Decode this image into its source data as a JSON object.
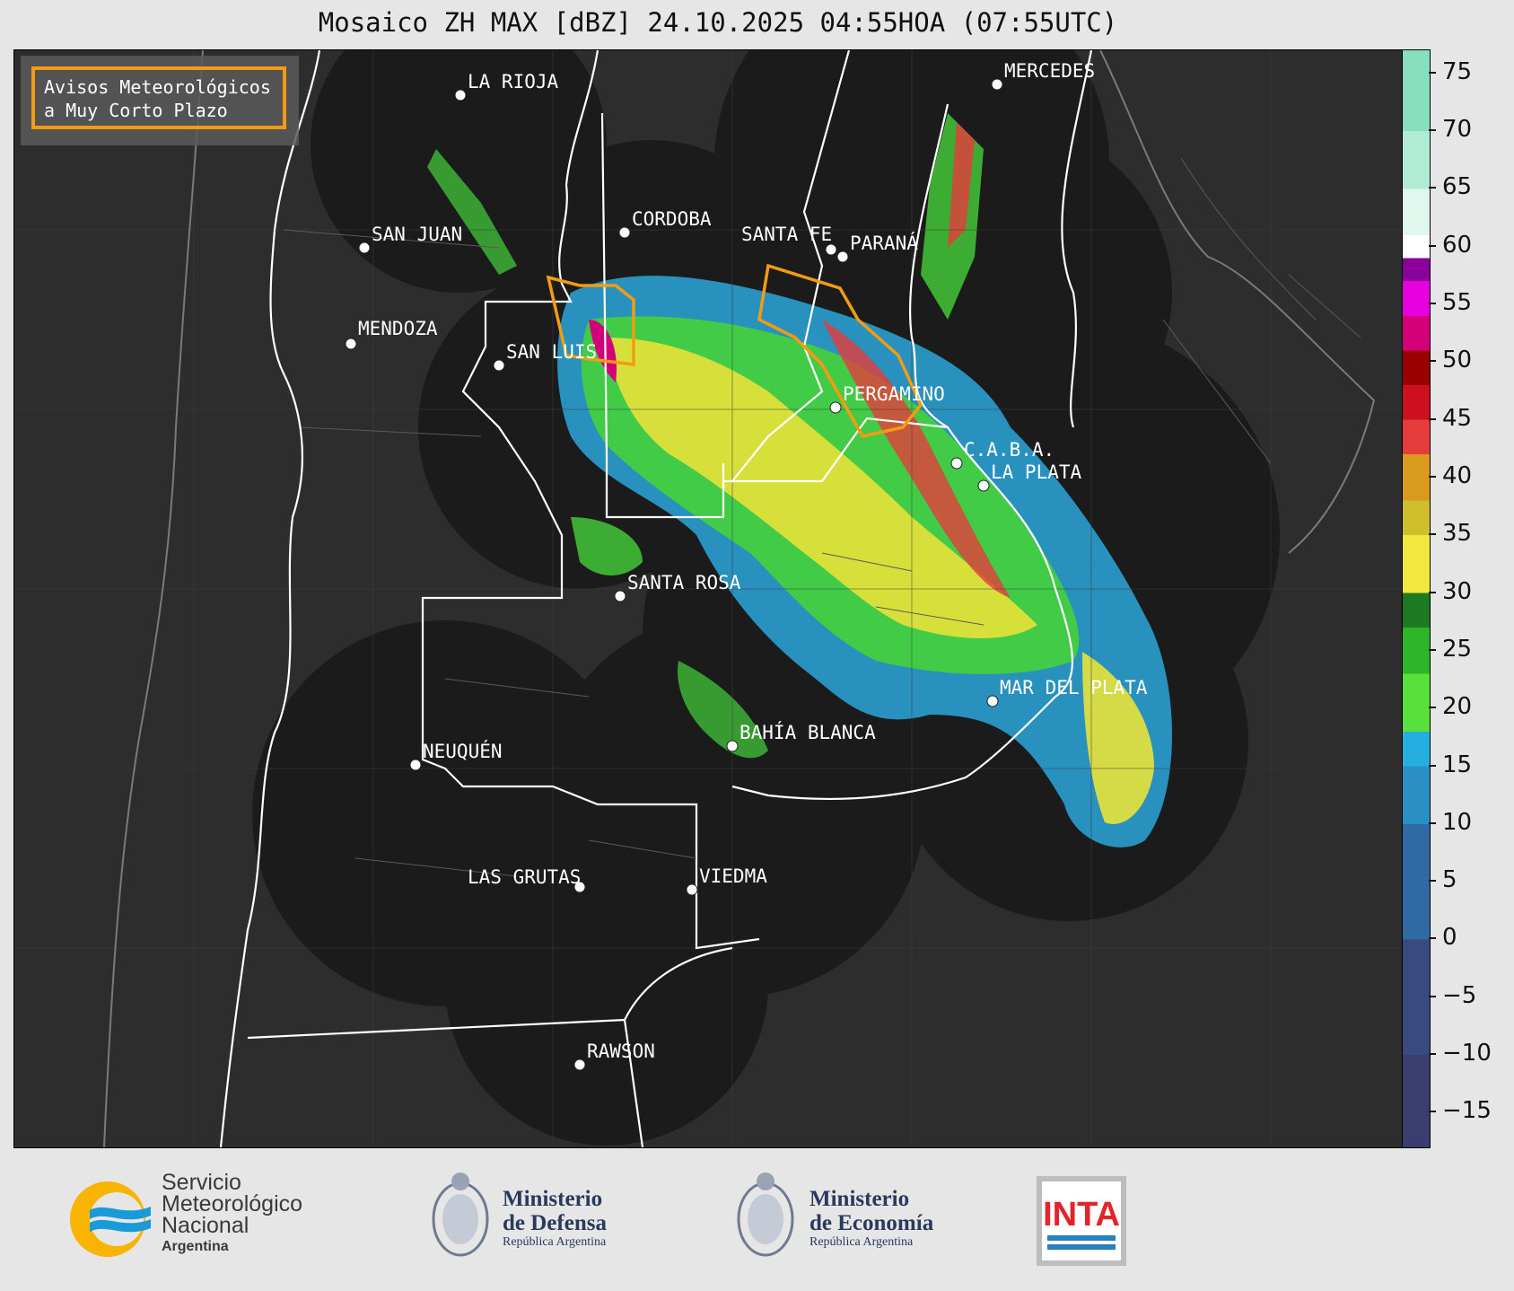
{
  "title": "Mosaico ZH MAX [dBZ] 24.10.2025 04:55HOA (07:55UTC)",
  "warning_legend": {
    "line1": "Avisos Meteorológicos",
    "line2": "a Muy Corto Plazo",
    "color": "#f39c12"
  },
  "cities": [
    {
      "name": "LA RIOJA"
    },
    {
      "name": "MERCEDES"
    },
    {
      "name": "CORDOBA"
    },
    {
      "name": "SAN JUAN"
    },
    {
      "name": "SANTA FE"
    },
    {
      "name": "PARANÁ"
    },
    {
      "name": "MENDOZA"
    },
    {
      "name": "SAN LUIS"
    },
    {
      "name": "PERGAMINO"
    },
    {
      "name": "C.A.B.A."
    },
    {
      "name": "LA PLATA"
    },
    {
      "name": "SANTA ROSA"
    },
    {
      "name": "MAR DEL PLATA"
    },
    {
      "name": "BAHÍA BLANCA"
    },
    {
      "name": "NEUQUÉN"
    },
    {
      "name": "LAS GRUTAS"
    },
    {
      "name": "VIEDMA"
    },
    {
      "name": "RAWSON"
    }
  ],
  "colorbar": {
    "unit": "dBZ",
    "min": -18,
    "max": 77,
    "ticks": [
      "75",
      "70",
      "65",
      "60",
      "55",
      "50",
      "45",
      "40",
      "35",
      "30",
      "25",
      "20",
      "15",
      "10",
      "5",
      "0",
      "−5",
      "−10",
      "−15"
    ],
    "stops": [
      {
        "from": -18,
        "color": "#3a3d6e"
      },
      {
        "from": -10,
        "color": "#394a80"
      },
      {
        "from": 0,
        "color": "#2f6aa3"
      },
      {
        "from": 10,
        "color": "#2a8fc4"
      },
      {
        "from": 15,
        "color": "#25aee0"
      },
      {
        "from": 18,
        "color": "#5ae03a"
      },
      {
        "from": 23,
        "color": "#2fb52a"
      },
      {
        "from": 27,
        "color": "#1e7a22"
      },
      {
        "from": 30,
        "color": "#f0e83c"
      },
      {
        "from": 35,
        "color": "#cfbf2a"
      },
      {
        "from": 38,
        "color": "#d99a1e"
      },
      {
        "from": 42,
        "color": "#e63c3c"
      },
      {
        "from": 45,
        "color": "#cc1020"
      },
      {
        "from": 48,
        "color": "#9a0000"
      },
      {
        "from": 51,
        "color": "#d4007a"
      },
      {
        "from": 54,
        "color": "#e600e0"
      },
      {
        "from": 57,
        "color": "#8a009a"
      },
      {
        "from": 59,
        "color": "#ffffff"
      },
      {
        "from": 61,
        "color": "#dff7ec"
      },
      {
        "from": 65,
        "color": "#b0ecd3"
      },
      {
        "from": 70,
        "color": "#88dfbd"
      }
    ]
  },
  "footer": {
    "smn": {
      "line1": "Servicio",
      "line2": "Meteorológico",
      "line3": "Nacional",
      "sub": "Argentina"
    },
    "defensa": {
      "line1": "Ministerio",
      "line2": "de Defensa",
      "sub": "República Argentina"
    },
    "economia": {
      "line1": "Ministerio",
      "line2": "de Economía",
      "sub": "República Argentina"
    },
    "inta": {
      "label": "INTA"
    }
  }
}
